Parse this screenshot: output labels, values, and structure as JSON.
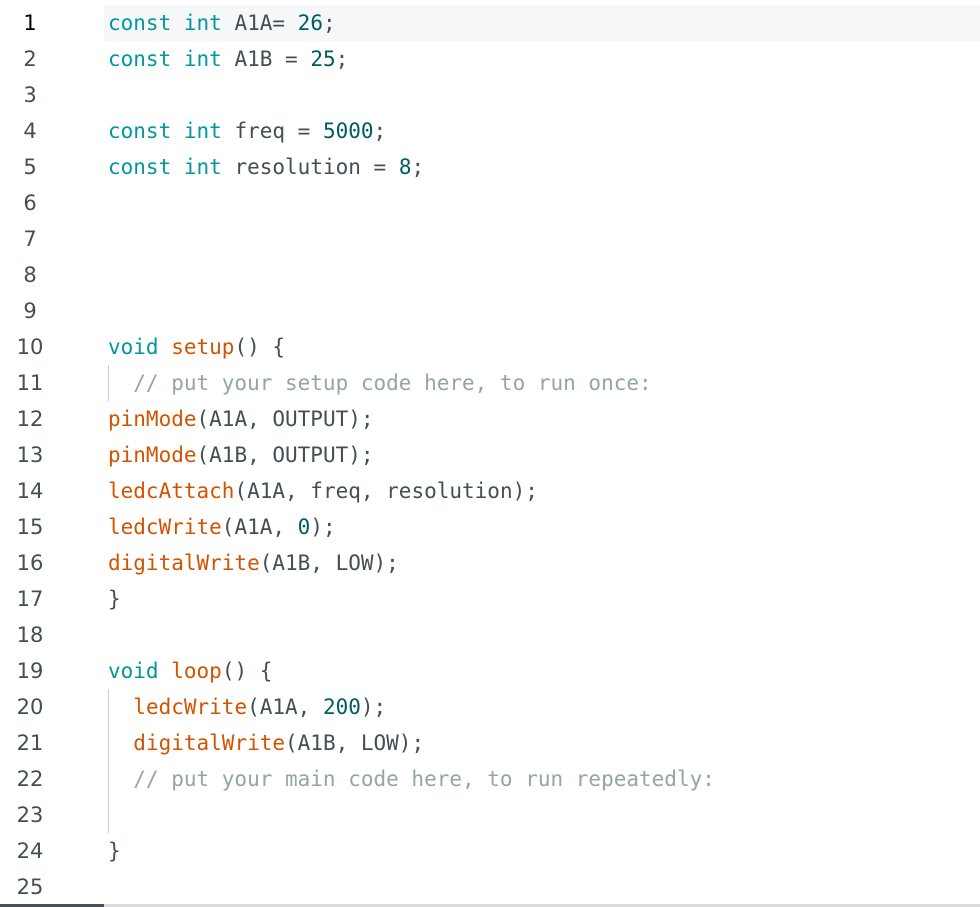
{
  "editor": {
    "current_line": 1,
    "colors": {
      "keyword": "#00979d",
      "function": "#d35400",
      "identifier": "#434f54",
      "number": "#005c5f",
      "comment": "#95a5a6",
      "gutter_text": "#434f54",
      "current_line_bg": "#f5f7f8"
    },
    "lines": [
      {
        "n": "1",
        "tokens": [
          {
            "t": "const",
            "c": "keyword"
          },
          {
            "t": " ",
            "c": "identifier"
          },
          {
            "t": "int",
            "c": "keyword"
          },
          {
            "t": " A1A= ",
            "c": "identifier"
          },
          {
            "t": "26",
            "c": "number"
          },
          {
            "t": ";",
            "c": "identifier"
          }
        ]
      },
      {
        "n": "2",
        "tokens": [
          {
            "t": "const",
            "c": "keyword"
          },
          {
            "t": " ",
            "c": "identifier"
          },
          {
            "t": "int",
            "c": "keyword"
          },
          {
            "t": " A1B = ",
            "c": "identifier"
          },
          {
            "t": "25",
            "c": "number"
          },
          {
            "t": ";",
            "c": "identifier"
          }
        ]
      },
      {
        "n": "3",
        "tokens": []
      },
      {
        "n": "4",
        "tokens": [
          {
            "t": "const",
            "c": "keyword"
          },
          {
            "t": " ",
            "c": "identifier"
          },
          {
            "t": "int",
            "c": "keyword"
          },
          {
            "t": " freq = ",
            "c": "identifier"
          },
          {
            "t": "5000",
            "c": "number"
          },
          {
            "t": ";",
            "c": "identifier"
          }
        ]
      },
      {
        "n": "5",
        "tokens": [
          {
            "t": "const",
            "c": "keyword"
          },
          {
            "t": " ",
            "c": "identifier"
          },
          {
            "t": "int",
            "c": "keyword"
          },
          {
            "t": " resolution = ",
            "c": "identifier"
          },
          {
            "t": "8",
            "c": "number"
          },
          {
            "t": ";",
            "c": "identifier"
          }
        ]
      },
      {
        "n": "6",
        "tokens": []
      },
      {
        "n": "7",
        "tokens": []
      },
      {
        "n": "8",
        "tokens": []
      },
      {
        "n": "9",
        "tokens": []
      },
      {
        "n": "10",
        "tokens": [
          {
            "t": "void",
            "c": "keyword"
          },
          {
            "t": " ",
            "c": "identifier"
          },
          {
            "t": "setup",
            "c": "function"
          },
          {
            "t": "() {",
            "c": "identifier"
          }
        ]
      },
      {
        "n": "11",
        "tokens": [
          {
            "t": "  // put your setup code here, to run once:",
            "c": "comment"
          }
        ]
      },
      {
        "n": "12",
        "tokens": [
          {
            "t": "pinMode",
            "c": "function"
          },
          {
            "t": "(A1A, OUTPUT);",
            "c": "identifier"
          }
        ]
      },
      {
        "n": "13",
        "tokens": [
          {
            "t": "pinMode",
            "c": "function"
          },
          {
            "t": "(A1B, OUTPUT);",
            "c": "identifier"
          }
        ]
      },
      {
        "n": "14",
        "tokens": [
          {
            "t": "ledcAttach",
            "c": "function"
          },
          {
            "t": "(A1A, freq, resolution);",
            "c": "identifier"
          }
        ]
      },
      {
        "n": "15",
        "tokens": [
          {
            "t": "ledcWrite",
            "c": "function"
          },
          {
            "t": "(A1A, ",
            "c": "identifier"
          },
          {
            "t": "0",
            "c": "number"
          },
          {
            "t": ");",
            "c": "identifier"
          }
        ]
      },
      {
        "n": "16",
        "tokens": [
          {
            "t": "digitalWrite",
            "c": "function"
          },
          {
            "t": "(A1B, LOW);",
            "c": "identifier"
          }
        ]
      },
      {
        "n": "17",
        "tokens": [
          {
            "t": "}",
            "c": "identifier"
          }
        ]
      },
      {
        "n": "18",
        "tokens": []
      },
      {
        "n": "19",
        "tokens": [
          {
            "t": "void",
            "c": "keyword"
          },
          {
            "t": " ",
            "c": "identifier"
          },
          {
            "t": "loop",
            "c": "function"
          },
          {
            "t": "() {",
            "c": "identifier"
          }
        ]
      },
      {
        "n": "20",
        "tokens": [
          {
            "t": "  ",
            "c": "identifier"
          },
          {
            "t": "ledcWrite",
            "c": "function"
          },
          {
            "t": "(A1A, ",
            "c": "identifier"
          },
          {
            "t": "200",
            "c": "number"
          },
          {
            "t": ");",
            "c": "identifier"
          }
        ]
      },
      {
        "n": "21",
        "tokens": [
          {
            "t": "  ",
            "c": "identifier"
          },
          {
            "t": "digitalWrite",
            "c": "function"
          },
          {
            "t": "(A1B, LOW);",
            "c": "identifier"
          }
        ]
      },
      {
        "n": "22",
        "tokens": [
          {
            "t": "  // put your main code here, to run repeatedly:",
            "c": "comment"
          }
        ]
      },
      {
        "n": "23",
        "tokens": []
      },
      {
        "n": "24",
        "tokens": [
          {
            "t": "}",
            "c": "identifier"
          }
        ]
      },
      {
        "n": "25",
        "tokens": []
      }
    ]
  }
}
